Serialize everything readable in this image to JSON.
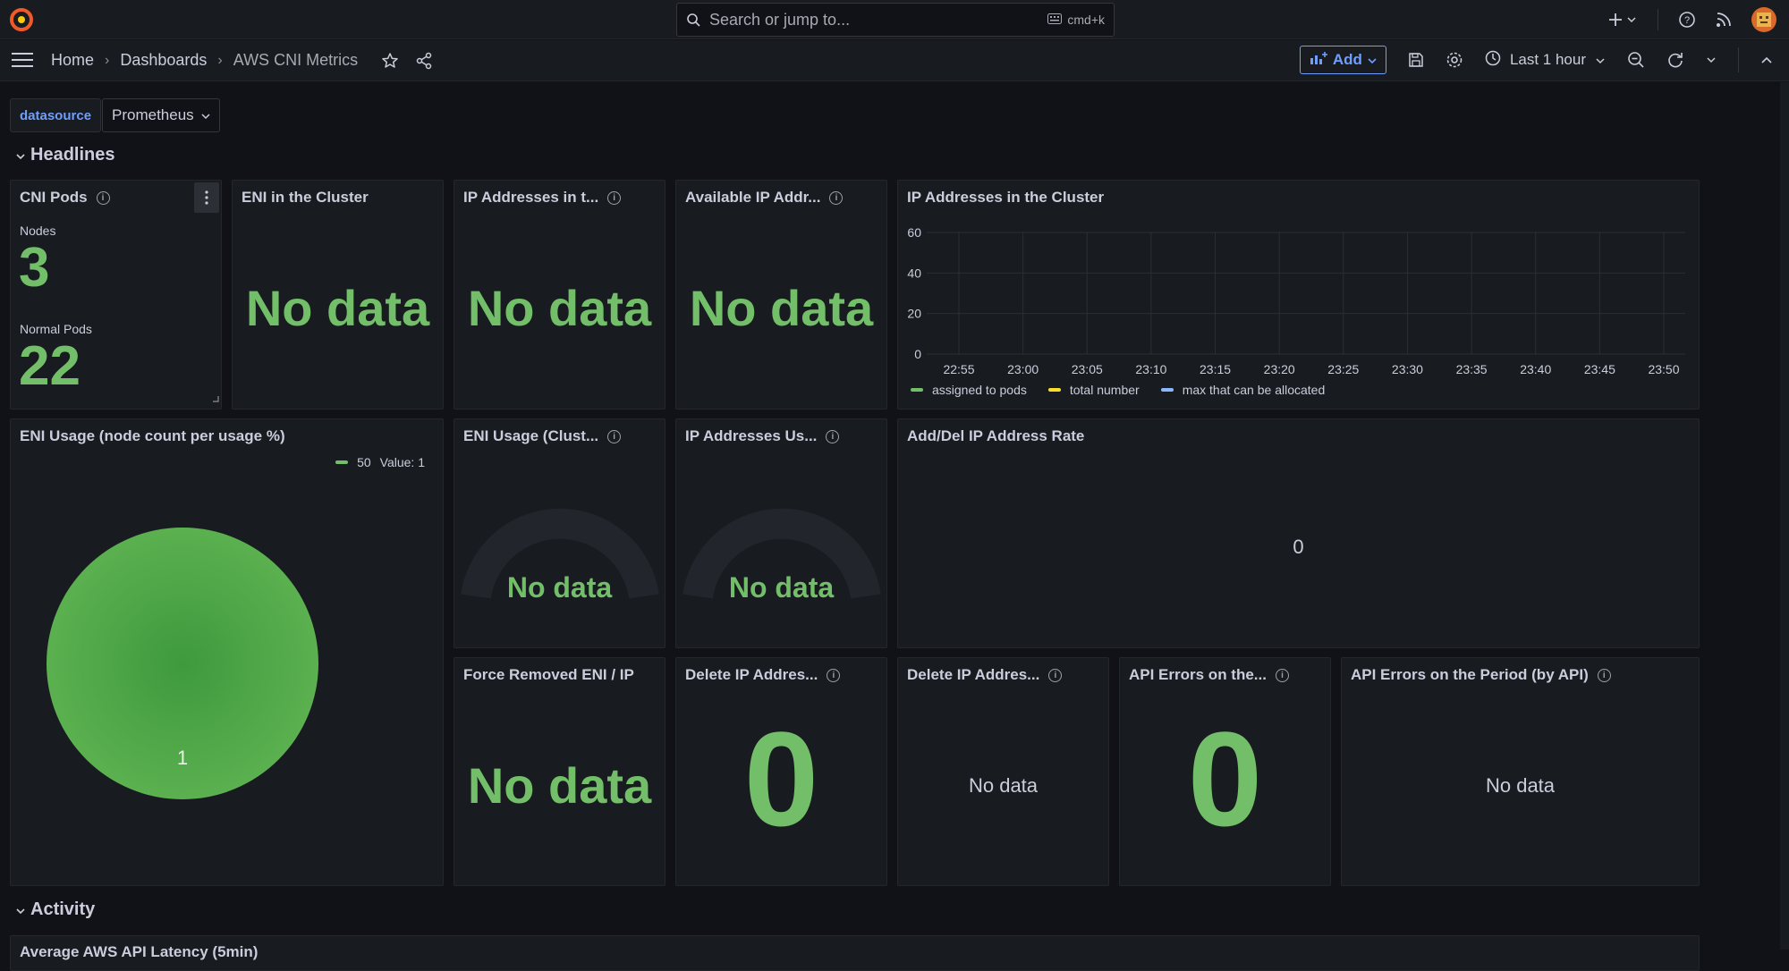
{
  "topbar": {
    "search_placeholder": "Search or jump to...",
    "search_shortcut": "cmd+k"
  },
  "breadcrumb": [
    "Home",
    "Dashboards",
    "AWS CNI Metrics"
  ],
  "nav": {
    "add_label": "Add",
    "time_range": "Last 1 hour"
  },
  "variables": {
    "label": "datasource",
    "value": "Prometheus"
  },
  "rows": {
    "headlines": "Headlines",
    "activity": "Activity",
    "next_panel_title": "Average AWS API Latency (5min)"
  },
  "panels": {
    "cni_pods": {
      "title": "CNI Pods",
      "nodes_label": "Nodes",
      "nodes_value": "3",
      "pods_label": "Normal Pods",
      "pods_value": "22"
    },
    "eni_cluster": {
      "title": "ENI in the Cluster",
      "value": "No data"
    },
    "ip_in_cluster_stat": {
      "title": "IP Addresses in t...",
      "value": "No data"
    },
    "available_ip": {
      "title": "Available IP Addr...",
      "value": "No data"
    },
    "ip_cluster_chart": {
      "title": "IP Addresses in the Cluster"
    },
    "eni_usage": {
      "title": "ENI Usage (node count per usage %)",
      "legend_name": "50",
      "legend_value": "Value: 1",
      "slice_label": "1"
    },
    "eni_usage_cluster": {
      "title": "ENI Usage (Clust...",
      "value": "No data"
    },
    "ip_usage": {
      "title": "IP Addresses Us...",
      "value": "No data"
    },
    "add_del_rate": {
      "title": "Add/Del IP Address Rate",
      "value": "0"
    },
    "force_removed": {
      "title": "Force Removed ENI / IP",
      "value": "No data"
    },
    "delete_ip_1": {
      "title": "Delete IP Addres...",
      "value": "0"
    },
    "delete_ip_2": {
      "title": "Delete IP Addres...",
      "value": "No data"
    },
    "api_errors": {
      "title": "API Errors on the...",
      "value": "0"
    },
    "api_errors_by_api": {
      "title": "API Errors on the Period (by API)",
      "value": "No data"
    }
  },
  "colors": {
    "green": "#73bf69",
    "yellow": "#fade2a",
    "blue": "#8ab8ff",
    "accent": "#6e9fff",
    "panel_bg": "#181b1f"
  },
  "chart_data": {
    "type": "line",
    "title": "IP Addresses in the Cluster",
    "x": [
      "22:55",
      "23:00",
      "23:05",
      "23:10",
      "23:15",
      "23:20",
      "23:25",
      "23:30",
      "23:35",
      "23:40",
      "23:45",
      "23:50"
    ],
    "yticks": [
      0,
      20,
      40,
      60
    ],
    "ylim": [
      0,
      60
    ],
    "grid": true,
    "legend_position": "bottom",
    "series": [
      {
        "name": "assigned to pods",
        "color": "#73bf69",
        "values": []
      },
      {
        "name": "total number",
        "color": "#fade2a",
        "values": []
      },
      {
        "name": "max that can be allocated",
        "color": "#8ab8ff",
        "values": []
      }
    ]
  }
}
